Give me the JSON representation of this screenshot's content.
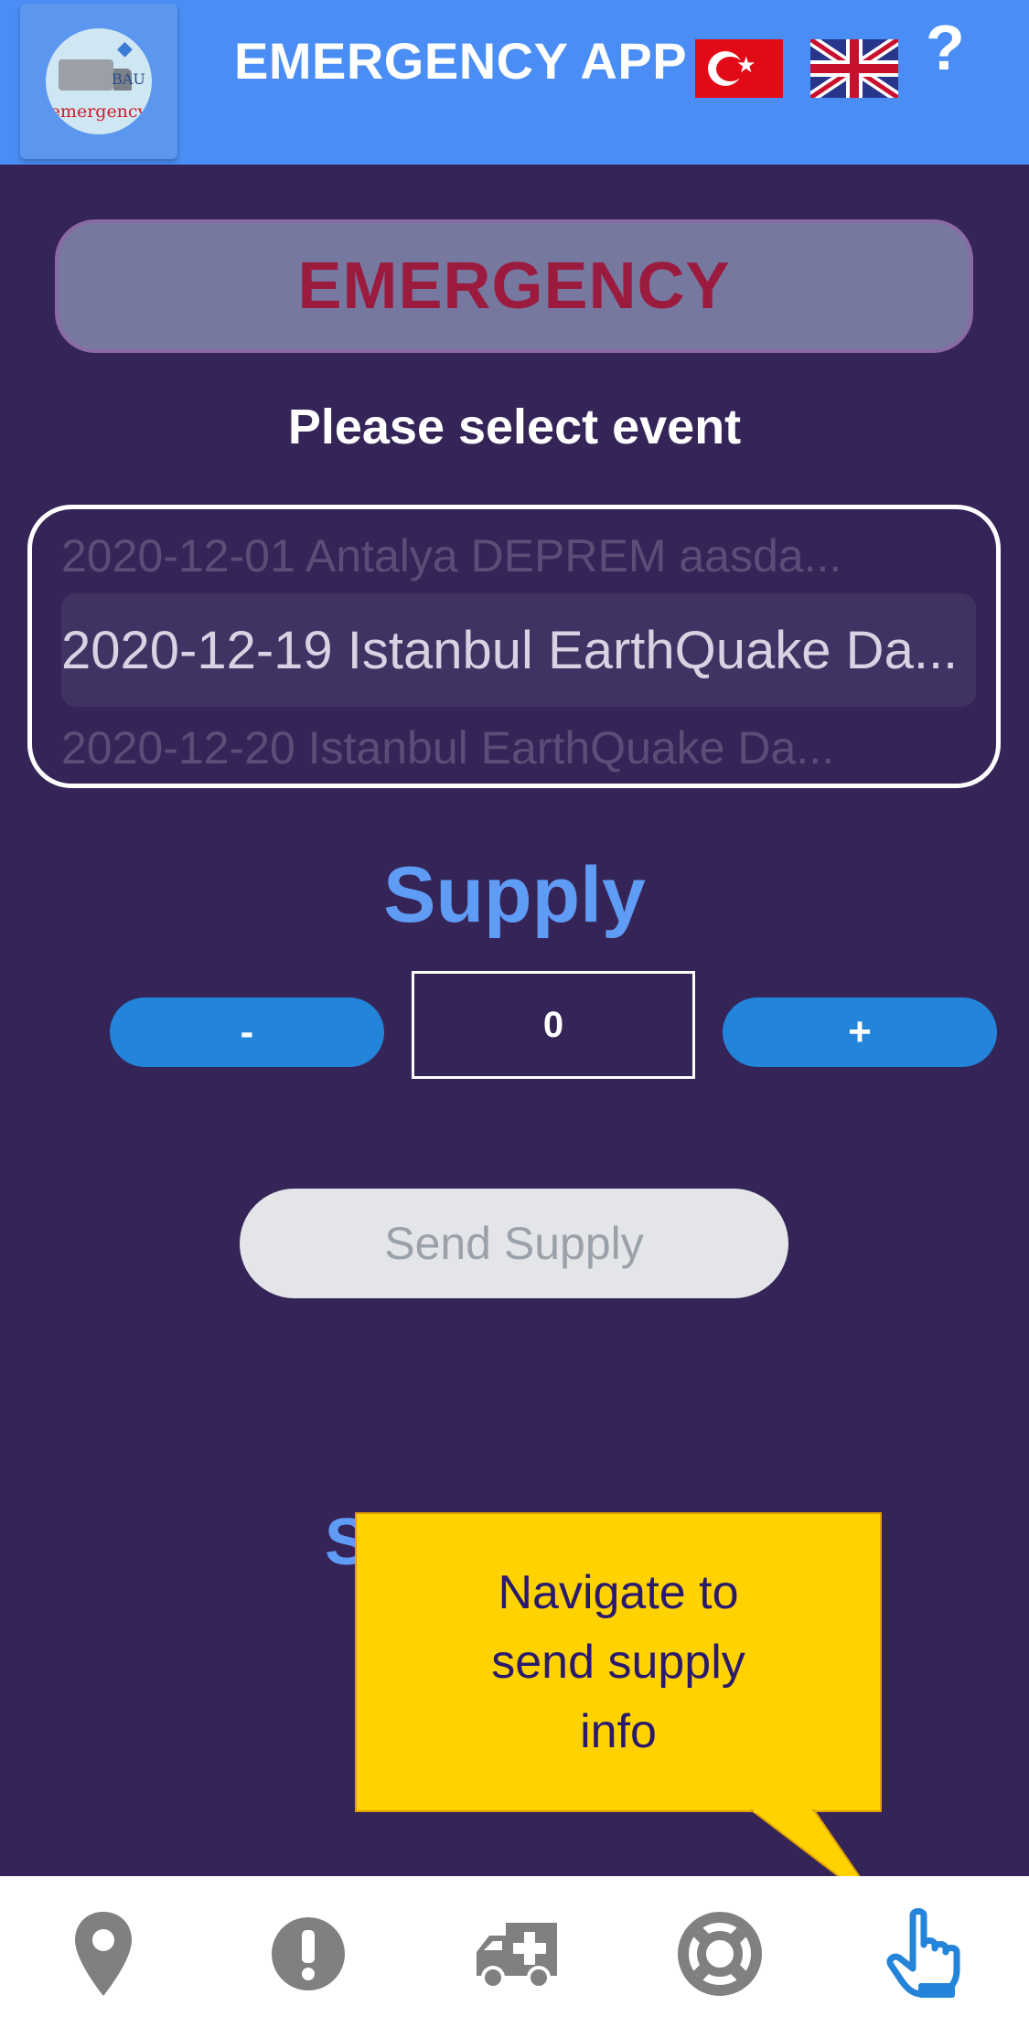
{
  "header": {
    "app_title": "EMERGENCY APP",
    "logo_text": "emergency",
    "logo_mark": "BAU",
    "help_label": "?"
  },
  "banner": {
    "label": "EMERGENCY"
  },
  "event_select": {
    "prompt": "Please select event",
    "options": [
      "2020-12-01 Antalya DEPREM aasda...",
      "2020-12-19 Istanbul EarthQuake Da...",
      "2020-12-20 Istanbul EarthQuake Da..."
    ],
    "selected": "2020-12-19 Istanbul EarthQuake Da..."
  },
  "supply": {
    "title": "Supply",
    "minus_label": "-",
    "plus_label": "+",
    "quantity": "0",
    "send_label": "Send Supply",
    "section_partial": "S"
  },
  "tooltip": {
    "text": "Navigate to send supply info"
  },
  "bottom_nav": [
    {
      "icon": "map-marker-icon",
      "color": "#808080"
    },
    {
      "icon": "exclamation-icon",
      "color": "#808080"
    },
    {
      "icon": "ambulance-icon",
      "color": "#808080"
    },
    {
      "icon": "life-ring-icon",
      "color": "#808080"
    },
    {
      "icon": "hand-pointer-icon",
      "color": "#2384da"
    }
  ],
  "colors": {
    "header": "#4a8ef5",
    "background": "#352457",
    "accent": "#5f9cf5",
    "stepper": "#2384da",
    "banner_text": "#9b1b3f",
    "tooltip": "#ffd200"
  }
}
